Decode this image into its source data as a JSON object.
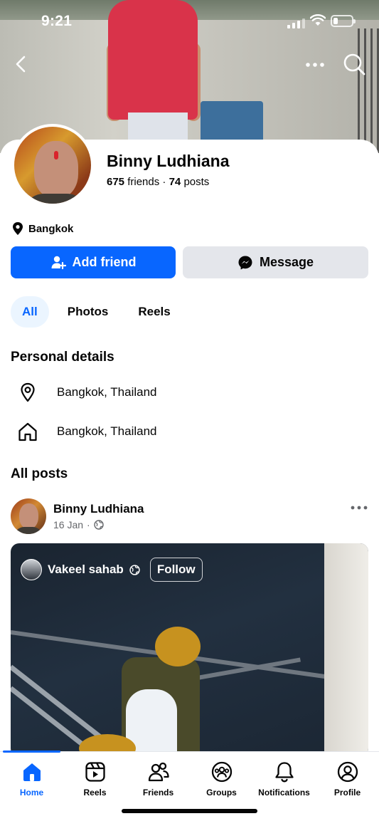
{
  "status_bar": {
    "time": "9:21"
  },
  "header": {
    "back_icon": "chevron-left-icon",
    "more_icon": "more-horizontal-icon",
    "search_icon": "search-icon"
  },
  "profile": {
    "name": "Binny Ludhiana",
    "friends_count": "675",
    "friends_label": "friends",
    "separator": "·",
    "posts_count": "74",
    "posts_label": "posts",
    "location": "Bangkok"
  },
  "actions": {
    "add_friend": "Add friend",
    "message": "Message"
  },
  "tabs": [
    {
      "label": "All",
      "active": true
    },
    {
      "label": "Photos",
      "active": false
    },
    {
      "label": "Reels",
      "active": false
    }
  ],
  "personal_details": {
    "title": "Personal details",
    "current_city": "Bangkok, Thailand",
    "hometown": "Bangkok, Thailand"
  },
  "posts": {
    "title": "All posts",
    "first_post": {
      "author": "Binny Ludhiana",
      "date": "16 Jan",
      "dot": "·",
      "shared_from": "Vakeel sahab",
      "follow_label": "Follow"
    }
  },
  "bottom_nav": [
    {
      "label": "Home",
      "icon": "home-icon",
      "active": true
    },
    {
      "label": "Reels",
      "icon": "reels-icon",
      "active": false
    },
    {
      "label": "Friends",
      "icon": "friends-icon",
      "active": false
    },
    {
      "label": "Groups",
      "icon": "groups-icon",
      "active": false
    },
    {
      "label": "Notifications",
      "icon": "bell-icon",
      "active": false
    },
    {
      "label": "Profile",
      "icon": "profile-icon",
      "active": false
    }
  ],
  "colors": {
    "accent": "#0866ff",
    "secondary_button": "#e4e6eb",
    "active_tab_bg": "#ebf5ff",
    "meta_text": "#65676b"
  }
}
